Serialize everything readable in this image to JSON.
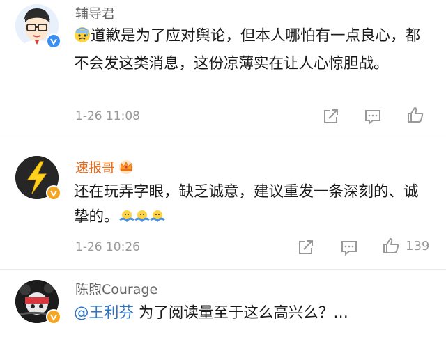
{
  "colors": {
    "link": "#2c74c4",
    "name_orange": "#e86b1a",
    "name_gray": "#666666",
    "meta": "#999999"
  },
  "comments": [
    {
      "username": "辅导君",
      "text": "道歉是为了应对舆论，但本人哪怕有一点良心，都不会发这类消息，这份凉薄实在让人心惊胆战。",
      "emoji_prefix": "cold-sweat-emoji",
      "time": "1-26 11:08",
      "likes": ""
    },
    {
      "username": "速报哥",
      "badge": "crown-icon",
      "text": "还在玩弄字眼，缺乏诚意，建议重发一条深刻的、诚挚的。",
      "emoji_suffix": [
        "shrug-emoji",
        "shrug-emoji",
        "shrug-emoji"
      ],
      "time": "1-26 10:26",
      "likes": "139"
    },
    {
      "username": "陈煦Courage",
      "mention": "@王利芬",
      "text": " 为了阅读量至于这么高兴么？…"
    }
  ]
}
